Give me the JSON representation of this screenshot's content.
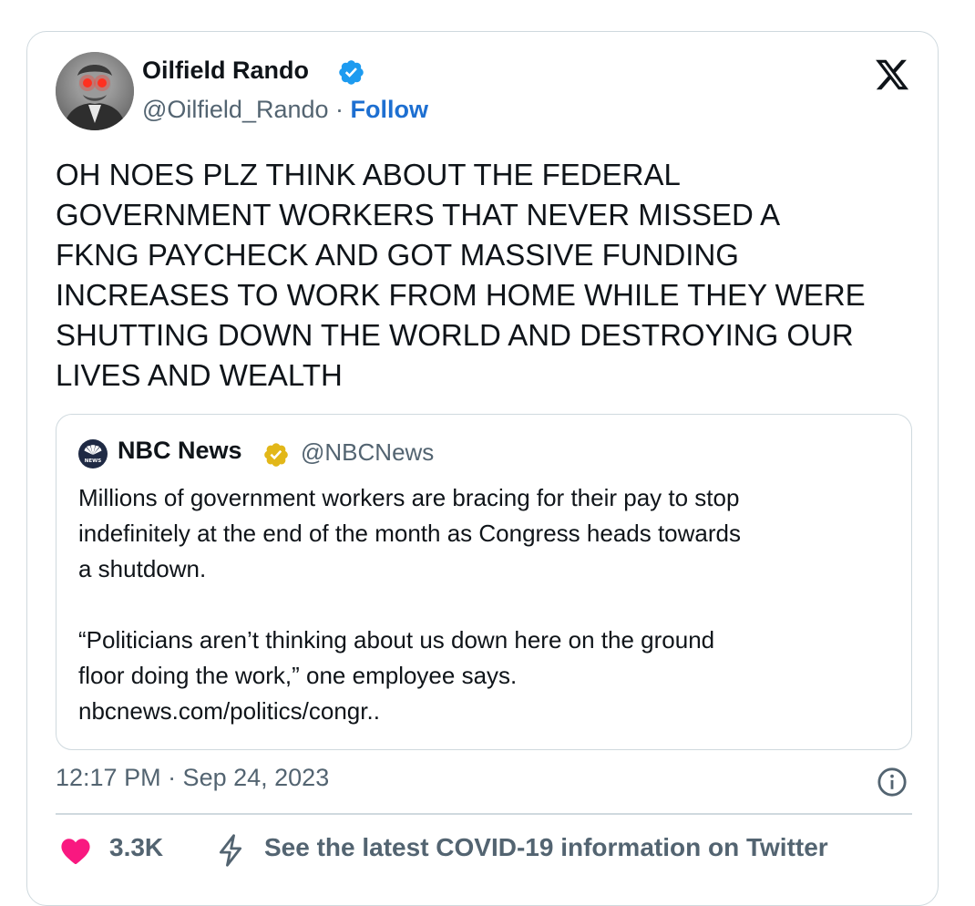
{
  "author": {
    "name": "Oilfield Rando",
    "handle": "@Oilfield_Rando",
    "separator": " · ",
    "follow_label": "Follow"
  },
  "tweet": {
    "lines": [
      "OH NOES PLZ THINK ABOUT THE FEDERAL",
      "GOVERNMENT WORKERS THAT NEVER MISSED A",
      "FKNG PAYCHECK AND GOT MASSIVE FUNDING",
      "INCREASES TO WORK FROM HOME WHILE THEY WERE",
      "SHUTTING DOWN THE WORLD AND DESTROYING OUR",
      "LIVES AND WEALTH"
    ]
  },
  "quoted": {
    "name": "NBC News",
    "handle": "@NBCNews",
    "para1": [
      "Millions of government workers are bracing for their pay to stop",
      "indefinitely at the end of the month as Congress heads towards",
      "a shutdown."
    ],
    "para2": [
      "“Politicians aren’t thinking about us down here on the ground",
      "floor doing the work,” one employee says.",
      "nbcnews.com/politics/congr.."
    ]
  },
  "timestamp": "12:17 PM · Sep 24, 2023",
  "footer": {
    "like_count": "3.3K",
    "covid_label": "See the latest COVID-19 information on Twitter"
  },
  "colors": {
    "follow_blue": "#1d6fd1",
    "verified_blue": "#1d9bf0",
    "gold_badge": "#e2b719",
    "heart_pink": "#f91880",
    "secondary_text": "#536471",
    "border": "#cfd9de"
  },
  "icons": {
    "verified": "verified-badge-icon",
    "gold_verified": "gold-verified-badge-icon",
    "x_logo": "x-logo-icon",
    "nbc_logo": "nbc-peacock-icon",
    "info": "info-icon",
    "heart": "heart-icon",
    "bolt": "lightning-bolt-icon"
  }
}
